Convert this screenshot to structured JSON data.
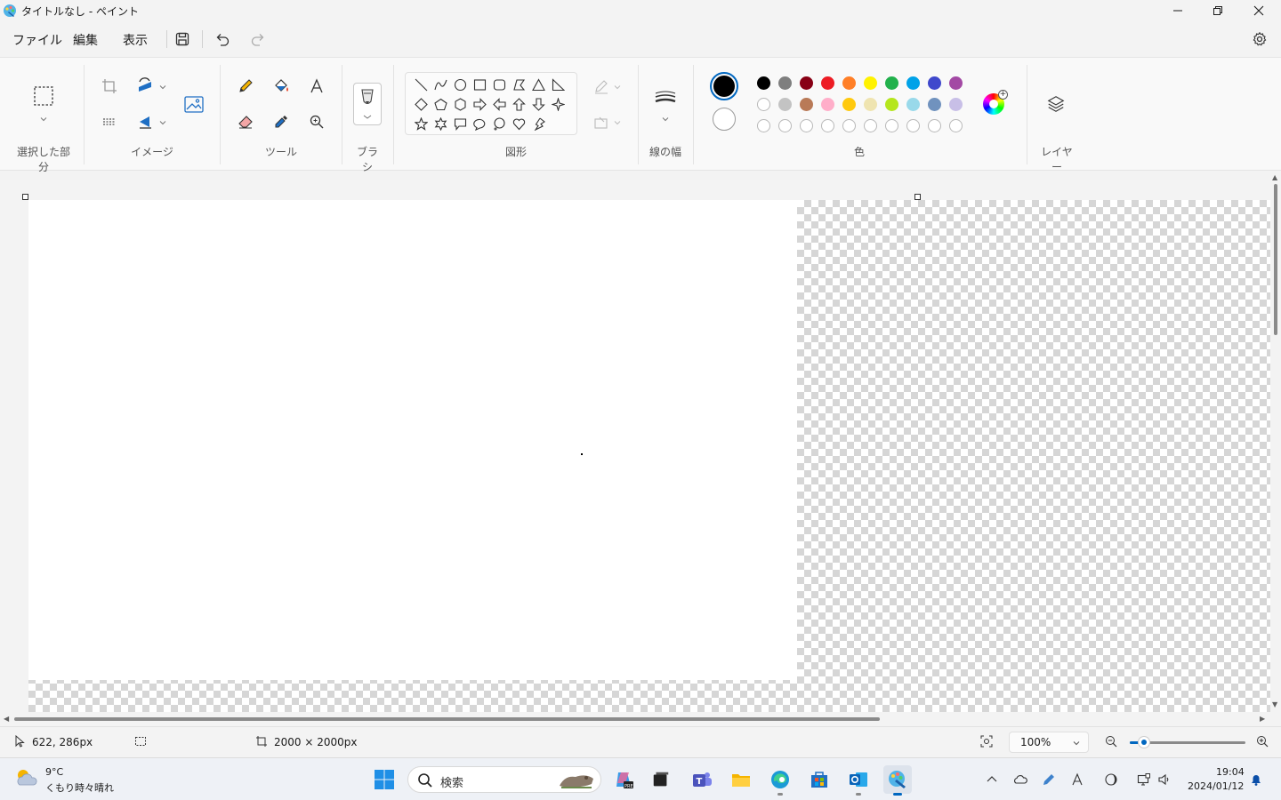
{
  "window": {
    "title": "タイトルなし - ペイント"
  },
  "menu": {
    "file": "ファイル",
    "edit": "編集",
    "view": "表示"
  },
  "ribbon": {
    "groups": {
      "selection": "選択した部分",
      "image": "イメージ",
      "tools": "ツール",
      "brushes": "ブラシ",
      "shapes": "図形",
      "stroke_width": "線の幅",
      "colors": "色",
      "layers": "レイヤー"
    },
    "colors": {
      "primary": "#000000",
      "secondary": "#ffffff",
      "row1": [
        "#000000",
        "#7f7f7f",
        "#880015",
        "#ed1c24",
        "#ff7f27",
        "#fff200",
        "#22b14c",
        "#00a2e8",
        "#3f48cc",
        "#a349a4"
      ],
      "row2": [
        "#ffffff",
        "#c3c3c3",
        "#b97a57",
        "#ffaec9",
        "#ffc90e",
        "#efe4b0",
        "#b5e61d",
        "#99d9ea",
        "#7092be",
        "#c8bfe7"
      ],
      "row3_empty_count": 10
    }
  },
  "status": {
    "cursor_position": "622, 286px",
    "canvas_size": "2000 × 2000px",
    "zoom": "100%",
    "zoom_fraction": 0.12
  },
  "taskbar": {
    "weather_temp": "9°C",
    "weather_desc": "くもり時々晴れ",
    "search_placeholder": "検索",
    "time": "19:04",
    "date": "2024/01/12"
  }
}
